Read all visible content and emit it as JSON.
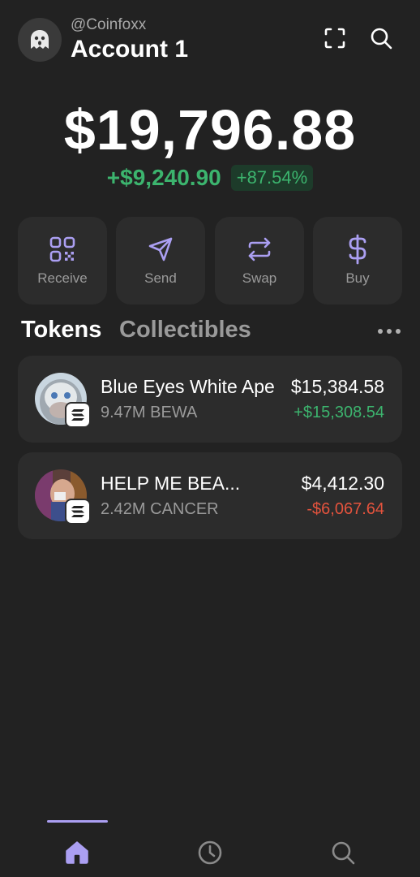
{
  "account": {
    "handle": "@Coinfoxx",
    "name": "Account 1",
    "avatar_icon": "ghost-icon"
  },
  "header_icons": [
    "scan-icon",
    "search-icon"
  ],
  "balance": {
    "total": "$19,796.88",
    "change_amount": "+$9,240.90",
    "change_percent": "+87.54%"
  },
  "actions": [
    {
      "label": "Receive",
      "icon": "qr-code-icon"
    },
    {
      "label": "Send",
      "icon": "send-icon"
    },
    {
      "label": "Swap",
      "icon": "swap-icon"
    },
    {
      "label": "Buy",
      "icon": "dollar-icon"
    }
  ],
  "tabs": {
    "active": "Tokens",
    "inactive": "Collectibles"
  },
  "tokens": [
    {
      "name": "Blue Eyes White Ape",
      "amount": "9.47M BEWA",
      "value": "$15,384.58",
      "change": "+$15,308.54",
      "change_color": "#3cb46e"
    },
    {
      "name": "HELP ME BEA...",
      "amount": "2.42M CANCER",
      "value": "$4,412.30",
      "change": "-$6,067.64",
      "change_color": "#e5533d"
    }
  ],
  "colors": {
    "accent": "#ab9ff2",
    "positive": "#3cb46e",
    "negative": "#e5533d",
    "background": "#222222",
    "card": "#2c2c2c"
  },
  "bottom_nav": [
    "home-icon",
    "history-icon",
    "search-icon"
  ]
}
